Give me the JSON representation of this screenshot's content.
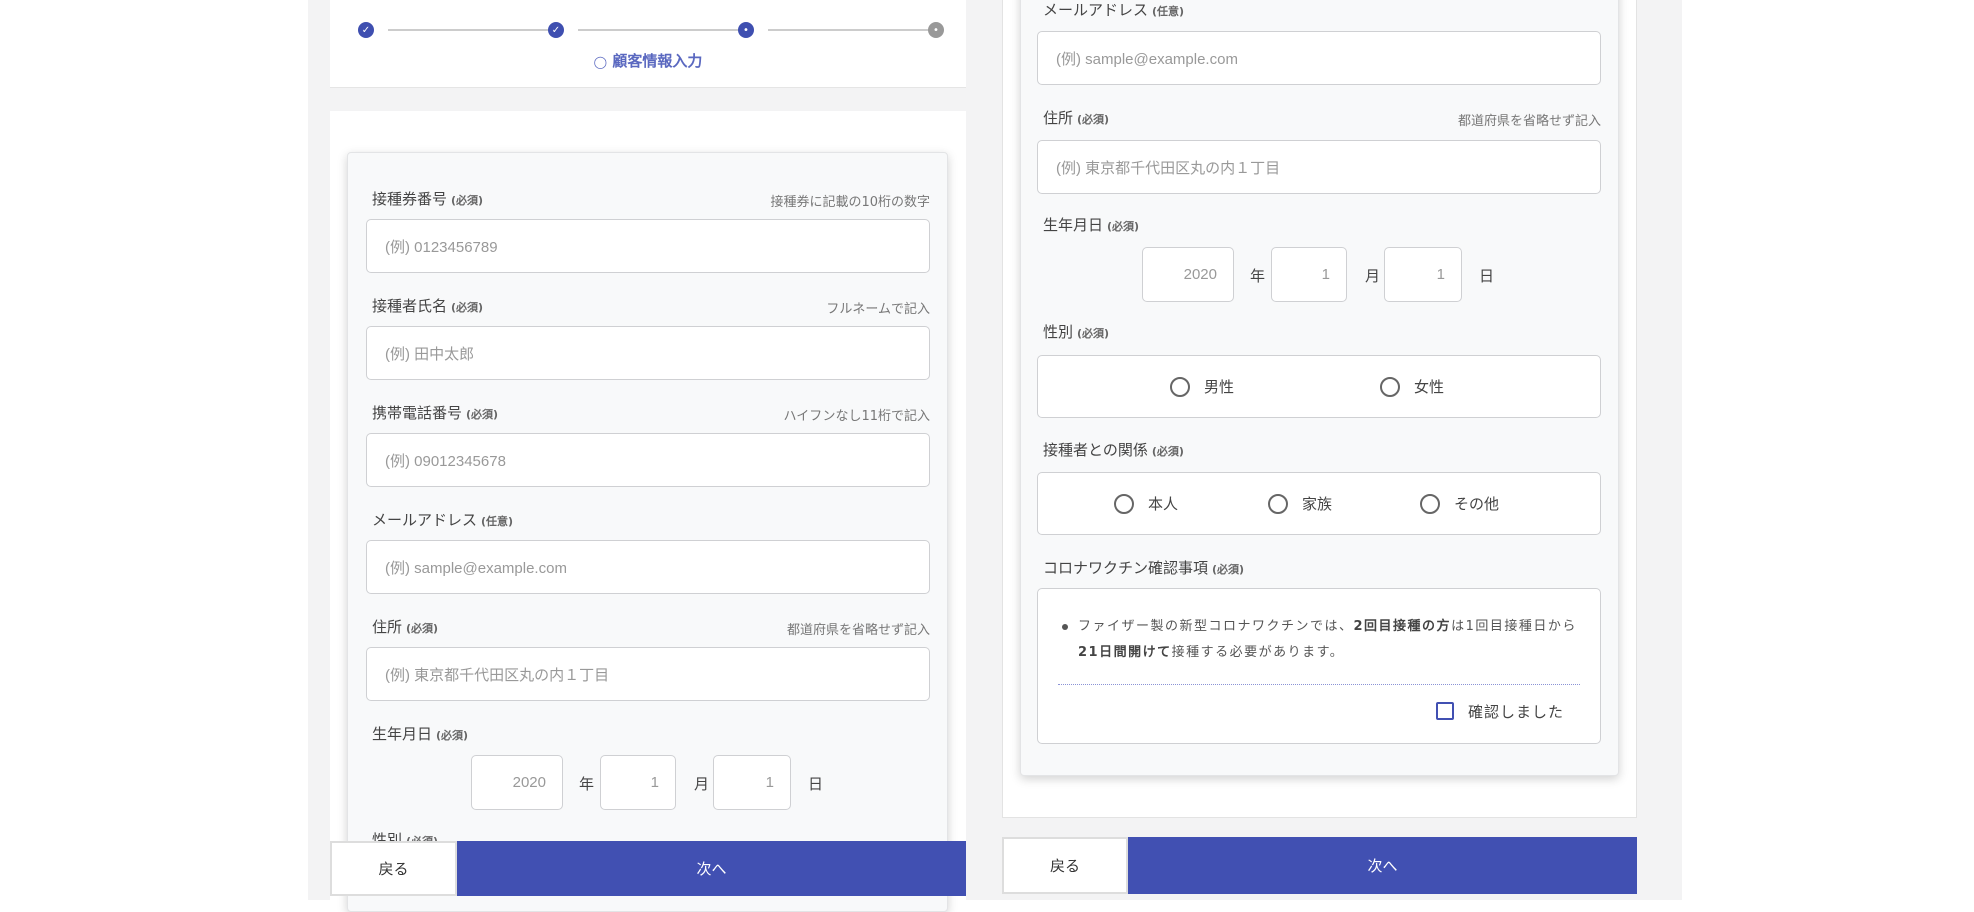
{
  "stepper": {
    "current_step_label": "顧客情報入力",
    "steps": [
      "done",
      "done",
      "current",
      "pending"
    ]
  },
  "fields": [
    {
      "label": "接種券番号",
      "req": "(必須)",
      "hint": "接種券に記載の10桁の数字",
      "placeholder": "(例) 0123456789"
    },
    {
      "label": "接種者氏名",
      "req": "(必須)",
      "hint": "フルネームで記入",
      "placeholder": "(例) 田中太郎"
    },
    {
      "label": "携帯電話番号",
      "req": "(必須)",
      "hint": "ハイフンなし11桁で記入",
      "placeholder": "(例) 09012345678"
    },
    {
      "label": "メールアドレス",
      "req": "(任意)",
      "hint": "",
      "placeholder": "(例) sample@example.com"
    },
    {
      "label": "住所",
      "req": "(必須)",
      "hint": "都道府県を省略せず記入",
      "placeholder": "(例) 東京都千代田区丸の内１丁目"
    }
  ],
  "birth": {
    "label": "生年月日",
    "req": "(必須)",
    "year": "2020",
    "year_unit": "年",
    "month": "1",
    "month_unit": "月",
    "day": "1",
    "day_unit": "日"
  },
  "gender": {
    "label": "性別",
    "req": "(必須)",
    "options": [
      "男性",
      "女性"
    ]
  },
  "relation": {
    "label": "接種者との関係",
    "req": "(必須)",
    "options": [
      "本人",
      "家族",
      "その他"
    ]
  },
  "vaccine": {
    "label": "コロナワクチン確認事項",
    "req": "(必須)",
    "t1": "ファイザー製の新型コロナワクチンでは、",
    "b1": "2回目接種の方",
    "t2": "は1回目接種日から",
    "b2": "21日間開けて",
    "t3": "接種する必要があります。",
    "confirm": "確認しました"
  },
  "buttons": {
    "back": "戻る",
    "next": "次へ"
  },
  "colors": {
    "primary": "#4150b2"
  }
}
